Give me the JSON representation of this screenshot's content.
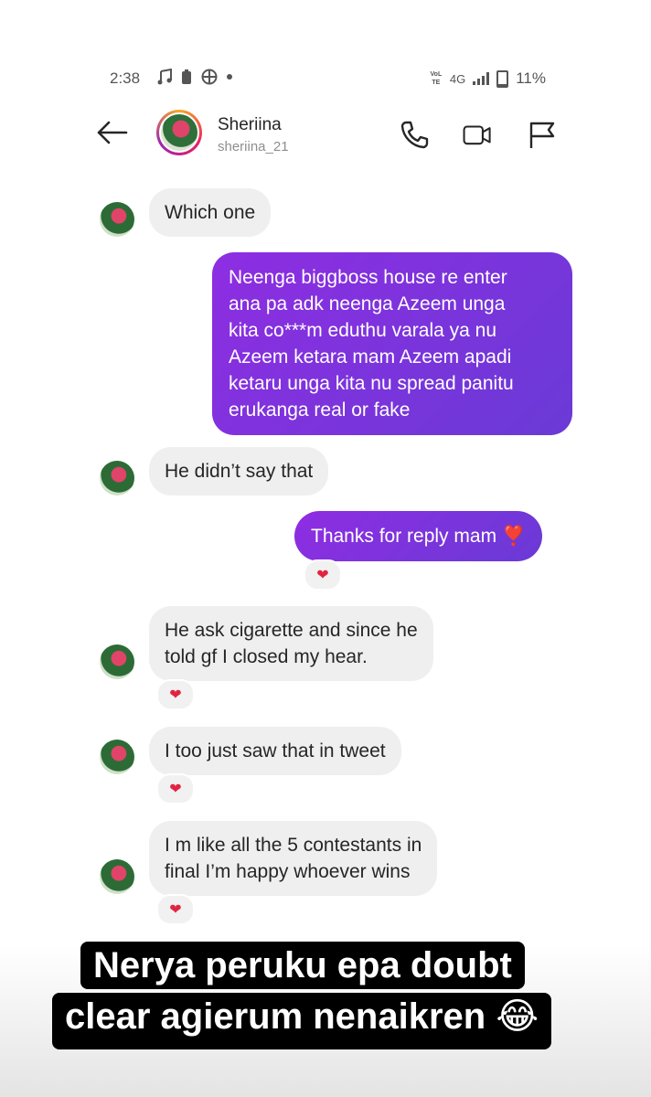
{
  "status_bar": {
    "time": "2:38",
    "network": "4G",
    "volte_label": "VoLTE",
    "battery": "11%"
  },
  "header": {
    "name": "Sheriina",
    "handle": "sheriina_21"
  },
  "messages": [
    {
      "from": "them",
      "text_lines": [
        "Which one"
      ]
    },
    {
      "from": "me",
      "text_lines": [
        "Neenga biggboss house re enter",
        "ana pa adk neenga Azeem unga",
        "kita co***m eduthu varala ya nu",
        "Azeem ketara mam Azeem apadi",
        "ketaru unga kita nu spread panitu",
        "erukanga real or fake"
      ]
    },
    {
      "from": "them",
      "text_lines": [
        "He didn’t say that"
      ]
    },
    {
      "from": "me",
      "text_lines": [
        "Thanks for reply mam ❣️"
      ],
      "reaction": "❤"
    },
    {
      "from": "them",
      "text_lines": [
        "He ask cigarette and since he",
        "told gf I closed my hear."
      ],
      "reaction": "❤"
    },
    {
      "from": "them",
      "text_lines": [
        "I too just saw that in tweet"
      ],
      "reaction": "❤"
    },
    {
      "from": "them",
      "text_lines": [
        "I m like all the 5 contestants in",
        "final I’m happy whoever wins"
      ],
      "reaction": "❤"
    }
  ],
  "caption": {
    "line1": "Nerya peruku epa doubt",
    "line2": "clear agierum nenaikren 😂"
  },
  "colors": {
    "outgoing_bubble_start": "#8e2de2",
    "outgoing_bubble_end": "#6a3ad6",
    "incoming_bubble": "#efefef",
    "reaction_heart": "#e02440"
  },
  "icons": [
    "back-arrow-icon",
    "phone-icon",
    "video-call-icon",
    "flag-icon",
    "music-note-icon",
    "battery-saver-icon",
    "globe-icon",
    "signal-icon",
    "battery-icon"
  ]
}
